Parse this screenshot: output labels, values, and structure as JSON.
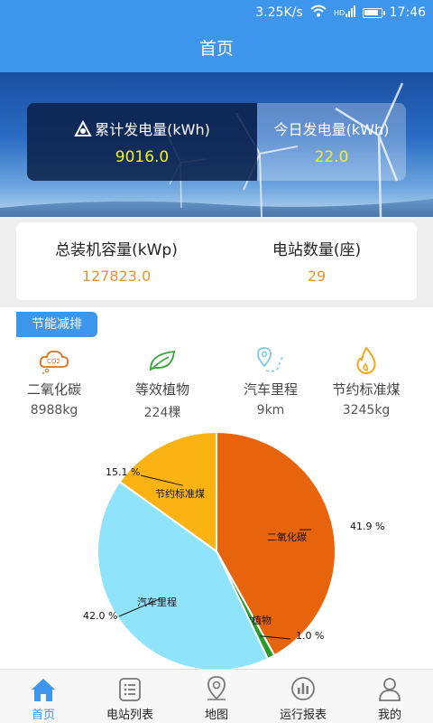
{
  "status_bar": {
    "speed": "3.25K/s",
    "time": "17:46",
    "battery_level": 0.9
  },
  "header": {
    "title": "首页"
  },
  "hero": {
    "total_label": "累计发电量(kWh)",
    "total_value": "9016.0",
    "today_label": "今日发电量(kWh)",
    "today_value": "22.0"
  },
  "capacity": {
    "installed_label": "总装机容量(kWp)",
    "installed_value": "127823.0",
    "stations_label": "电站数量(座)",
    "stations_value": "29"
  },
  "section": {
    "title": "节能减排"
  },
  "eco_stats": [
    {
      "label": "二氧化碳",
      "value": "8988kg",
      "icon": "co2-cloud-icon",
      "color": "#d9731c"
    },
    {
      "label": "等效植物",
      "value": "224棵",
      "icon": "leaf-icon",
      "color": "#3aa53a"
    },
    {
      "label": "汽车里程",
      "value": "9km",
      "icon": "route-pin-icon",
      "color": "#7fc8e6"
    },
    {
      "label": "节约标准煤",
      "value": "3245kg",
      "icon": "flame-icon",
      "color": "#f2a81c"
    }
  ],
  "chart_data": {
    "type": "pie",
    "slices": [
      {
        "label": "二氧化碳",
        "value": 41.9,
        "value_label": "41.9 %",
        "color": "#e8640c"
      },
      {
        "label": "等效植物",
        "value": 1.0,
        "value_label": "1.0 %",
        "color": "#2b9a2b"
      },
      {
        "label": "汽车里程",
        "value": 42.0,
        "value_label": "42.0 %",
        "color": "#8fe3fa"
      },
      {
        "label": "节约标准煤",
        "value": 15.1,
        "value_label": "15.1 %",
        "color": "#fbb313"
      }
    ]
  },
  "bottom_nav": [
    {
      "label": "首页",
      "icon": "home-icon",
      "active": true
    },
    {
      "label": "电站列表",
      "icon": "list-icon",
      "active": false
    },
    {
      "label": "地图",
      "icon": "map-pin-icon",
      "active": false
    },
    {
      "label": "运行报表",
      "icon": "report-chart-icon",
      "active": false
    },
    {
      "label": "我的",
      "icon": "user-icon",
      "active": false
    }
  ]
}
